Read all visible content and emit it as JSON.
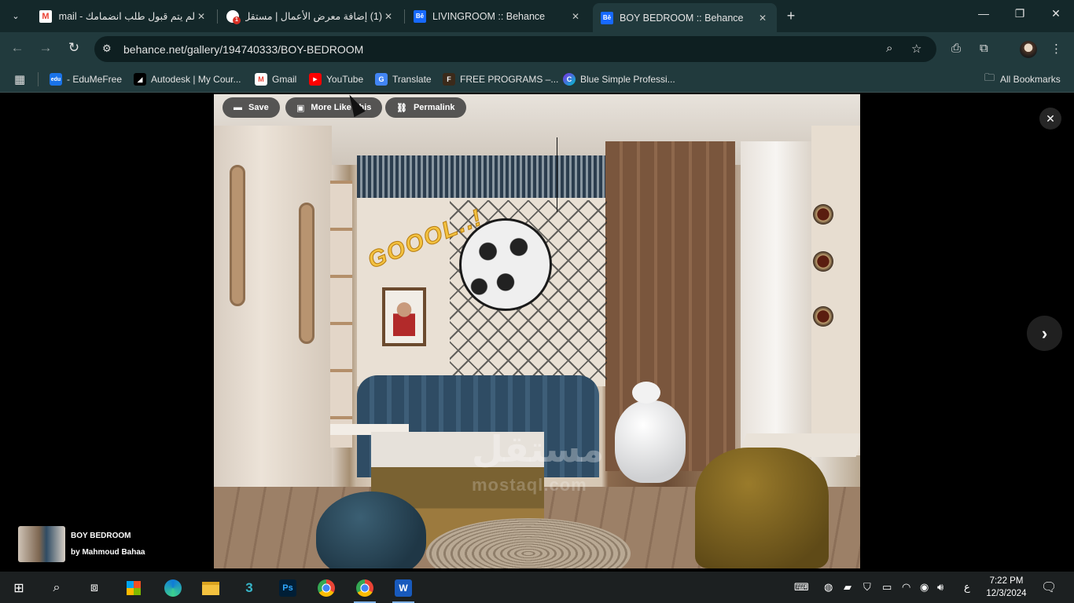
{
  "browser": {
    "tabs": [
      {
        "title": "لم يتم قبول طلب انضمامك - mail",
        "favicon": "gmail-icon",
        "active": false
      },
      {
        "title": "(1) إضافة معرض الأعمال | مستقل",
        "favicon": "mostaql-icon",
        "active": false
      },
      {
        "title": "LIVINGROOM :: Behance",
        "favicon": "behance-icon",
        "active": false
      },
      {
        "title": "BOY BEDROOM :: Behance",
        "favicon": "behance-icon",
        "active": true
      }
    ],
    "tab_close_glyph": "✕",
    "new_tab_glyph": "+",
    "tab_menu_glyph": "⌄",
    "url": "behance.net/gallery/194740333/BOY-BEDROOM",
    "behance_fav_text": "Bē",
    "mostaql_badge": "1",
    "bookmarks": [
      {
        "label": "- EduMeFree",
        "icon": "edu-icon",
        "fav_text": "edu"
      },
      {
        "label": "Autodesk | My Cour...",
        "icon": "autodesk-icon",
        "fav_text": "◢"
      },
      {
        "label": "Gmail",
        "icon": "gmail-icon",
        "fav_text": "M"
      },
      {
        "label": "YouTube",
        "icon": "youtube-icon",
        "fav_text": "▶"
      },
      {
        "label": "Translate",
        "icon": "translate-icon",
        "fav_text": "G"
      },
      {
        "label": "FREE PROGRAMS –...",
        "icon": "free-programs-icon",
        "fav_text": "F"
      },
      {
        "label": "Blue Simple Professi...",
        "icon": "canva-icon",
        "fav_text": "C"
      }
    ],
    "all_bookmarks": "All Bookmarks",
    "colors": {
      "chrome_dark": "#14282a",
      "toolbar": "#213a3d",
      "behance_blue": "#1769ff",
      "gmail_red": "#ea4335",
      "youtube_red": "#ff0000"
    }
  },
  "viewer": {
    "save_label": "Save",
    "more_like_label": "More Like This",
    "permalink_label": "Permalink",
    "close_glyph": "✕",
    "next_glyph": "›",
    "project_title": "BOY BEDROOM",
    "project_author": "by Mahmoud Bahaa",
    "artwork_text": "GOOOL..!"
  },
  "watermark": {
    "arabic": "مستقل",
    "latin": "mostaql.com"
  },
  "taskbar": {
    "apps": [
      "windows-start-icon",
      "search-icon",
      "task-view-icon",
      "store-icon",
      "edge-icon",
      "file-explorer-icon",
      "3ds-max-icon",
      "photoshop-icon",
      "chrome-icon",
      "chrome-profile-icon",
      "word-icon"
    ],
    "lang": "ع",
    "time": "7:22 PM",
    "date": "12/3/2024"
  }
}
